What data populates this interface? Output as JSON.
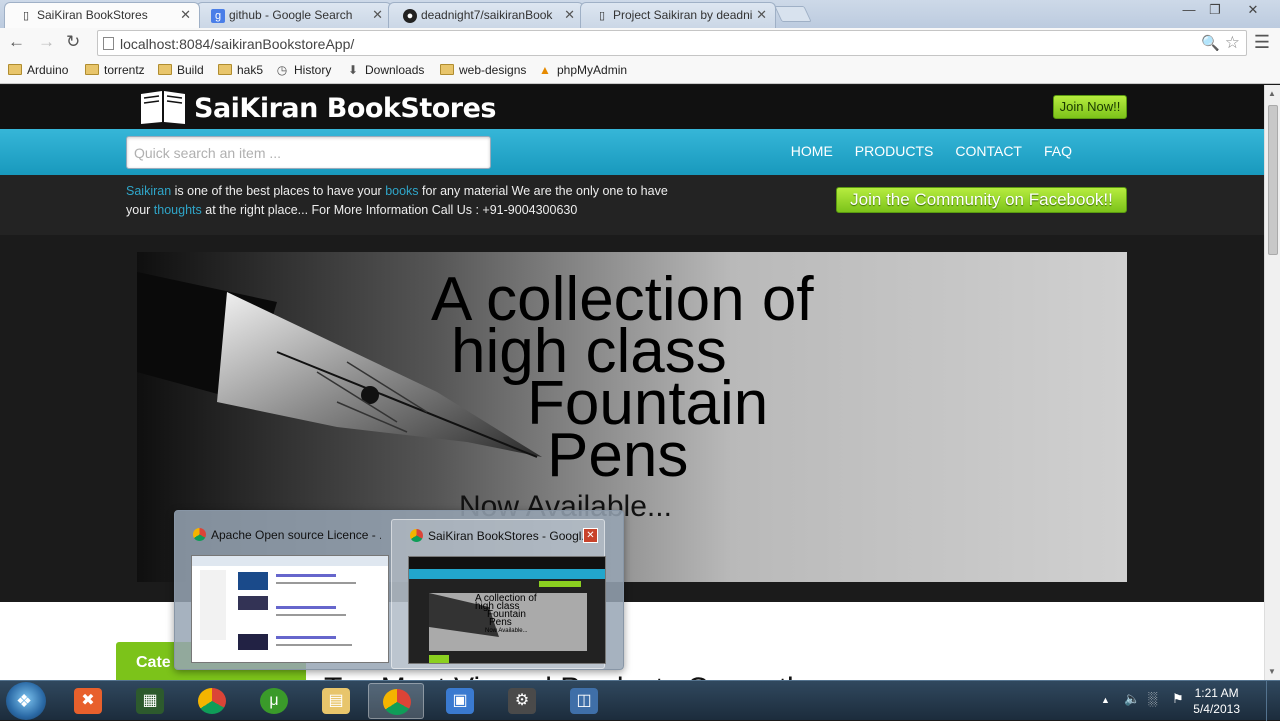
{
  "browser": {
    "tabs": [
      {
        "label": "SaiKiran BookStores",
        "icon": "page-icon"
      },
      {
        "label": "github - Google Search",
        "icon": "google-icon"
      },
      {
        "label": "deadnight7/saikiranBook",
        "icon": "github-icon"
      },
      {
        "label": "Project Saikiran by deadni",
        "icon": "page-icon"
      }
    ],
    "url": "localhost:8084/saikiranBookstoreApp/",
    "bookmarks": [
      {
        "label": "Arduino",
        "icon": "folder-icon"
      },
      {
        "label": "torrentz",
        "icon": "folder-icon"
      },
      {
        "label": "Build",
        "icon": "folder-icon"
      },
      {
        "label": "hak5",
        "icon": "folder-icon"
      },
      {
        "label": "History",
        "icon": "history-icon"
      },
      {
        "label": "Downloads",
        "icon": "download-icon"
      },
      {
        "label": "web-designs",
        "icon": "folder-icon"
      },
      {
        "label": "phpMyAdmin",
        "icon": "phpmyadmin-icon"
      }
    ]
  },
  "site": {
    "brand": "SaiKiran BookStores",
    "join_now": "Join Now!!",
    "search_placeholder": "Quick search an item ...",
    "nav": [
      "HOME",
      "PRODUCTS",
      "CONTACT",
      "FAQ"
    ],
    "info": {
      "w1": "Saikiran",
      "t1": " is one of the best places to have your ",
      "w2": "books",
      "t2": " for any material We are the only one to have your ",
      "w3": "thoughts",
      "t3": " at the right place... For More Information Call Us : +91-9004300630"
    },
    "facebook_button": "Join the Community on Facebook!!",
    "slide": {
      "line1": "A collection of",
      "line2": "high class",
      "line3": "Fountain",
      "line4": "Pens",
      "sub": "Now Available..."
    },
    "categories_button": "Cate",
    "section_heading": "Top Most Viewed Products Currently"
  },
  "taskbar_preview": {
    "items": [
      {
        "title": "Apache Open source Licence - ..."
      },
      {
        "title": "SaiKiran BookStores - Googl..."
      }
    ],
    "thumb_text": [
      "A collection of",
      "high class",
      "Fountain",
      "Pens",
      "Now Available..."
    ]
  },
  "taskbar": {
    "apps": [
      "xampp-icon",
      "terminal-icon",
      "chrome-icon",
      "utorrent-icon",
      "explorer-icon",
      "chrome-icon",
      "virtualbox-icon",
      "app-icon",
      "remote-desktop-icon"
    ],
    "time": "1:21 AM",
    "date": "5/4/2013"
  },
  "colors": {
    "accent_blue": "#1ea3c7",
    "accent_green": "#8bd020"
  }
}
